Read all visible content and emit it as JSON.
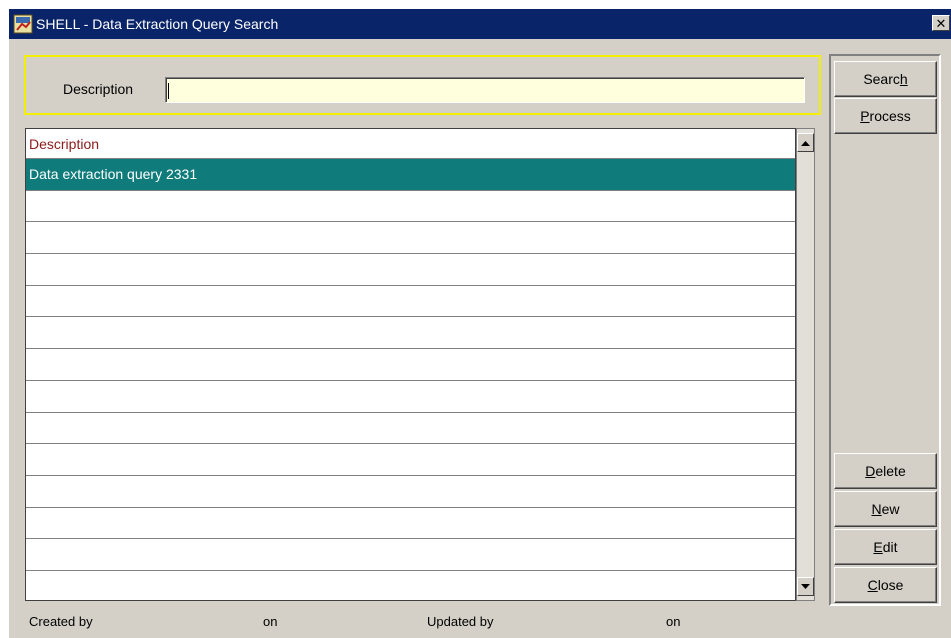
{
  "window": {
    "title": "SHELL - Data Extraction Query Search",
    "close_symbol": "✕"
  },
  "search": {
    "label": "Description",
    "value": "",
    "frame_color": "#f2f000"
  },
  "grid": {
    "column_header": "Description",
    "header_color": "#8b1a1a",
    "selection_color": "#0f7b7b",
    "rows": [
      "Data extraction query 2331",
      "",
      "",
      "",
      "",
      "",
      "",
      "",
      "",
      "",
      "",
      "",
      "",
      ""
    ]
  },
  "buttons": {
    "search": {
      "pre": "Searc",
      "ul": "h",
      "post": ""
    },
    "process": {
      "pre": "",
      "ul": "P",
      "post": "rocess"
    },
    "delete": {
      "pre": "",
      "ul": "D",
      "post": "elete"
    },
    "new": {
      "pre": "",
      "ul": "N",
      "post": "ew"
    },
    "edit": {
      "pre": "",
      "ul": "E",
      "post": "dit"
    },
    "close": {
      "pre": "",
      "ul": "C",
      "post": "lose"
    }
  },
  "footer": {
    "created_by": "Created by",
    "on_1": "on",
    "updated_by": "Updated by",
    "on_2": "on"
  },
  "icons": {
    "app": "app-icon",
    "close": "close-icon",
    "scroll_up": "scroll-up-icon",
    "scroll_down": "scroll-down-icon"
  }
}
